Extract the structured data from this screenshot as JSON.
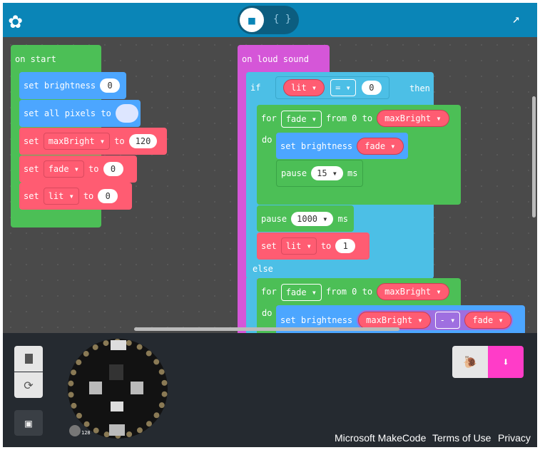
{
  "header": {
    "logo": "adafruit-flower-icon",
    "toggle_blocks": "puzzle-icon",
    "toggle_js": "{ }",
    "popout": "external-link-icon"
  },
  "on_start": {
    "label": "on start",
    "rows": [
      {
        "kw": "set brightness",
        "val": "0"
      },
      {
        "kw": "set all pixels to",
        "color": "#dde6ff"
      },
      {
        "kw": "set",
        "var": "maxBright ▾",
        "to": "to",
        "val": "120"
      },
      {
        "kw": "set",
        "var": "fade ▾",
        "to": "to",
        "val": "0"
      },
      {
        "kw": "set",
        "var": "lit ▾",
        "to": "to",
        "val": "0"
      }
    ]
  },
  "on_loud": {
    "label": "on loud sound",
    "if": "if",
    "lit": "lit ▾",
    "op": "= ▾",
    "zero": "0",
    "then": "then",
    "for1": {
      "for": "for",
      "var": "fade ▾",
      "from": "from 0 to",
      "to": "maxBright ▾",
      "do": "do",
      "setb": "set brightness",
      "fade": "fade ▾",
      "pause": "pause",
      "pv": "15 ▾",
      "ms": "ms"
    },
    "pause2": {
      "pause": "pause",
      "pv": "1000 ▾",
      "ms": "ms"
    },
    "setlit": {
      "set": "set",
      "var": "lit ▾",
      "to": "to",
      "val": "1"
    },
    "else": "else",
    "for2": {
      "for": "for",
      "var": "fade ▾",
      "from": "from 0 to",
      "to": "maxBright ▾",
      "do": "do",
      "setb": "set brightness",
      "a": "maxBright ▾",
      "op": "- ▾",
      "b": "fade ▾"
    }
  },
  "sim": {
    "stop": "stop-icon",
    "restart": "restart-icon",
    "screenshot": "screenshot-icon",
    "slow": "snail-icon",
    "download": "download-icon",
    "temp": "128"
  },
  "footer": {
    "makecode": "Microsoft MakeCode",
    "terms": "Terms of Use",
    "privacy": "Privacy"
  },
  "colors": {
    "header": "#0a85b7",
    "download": "#ff3cc8"
  }
}
